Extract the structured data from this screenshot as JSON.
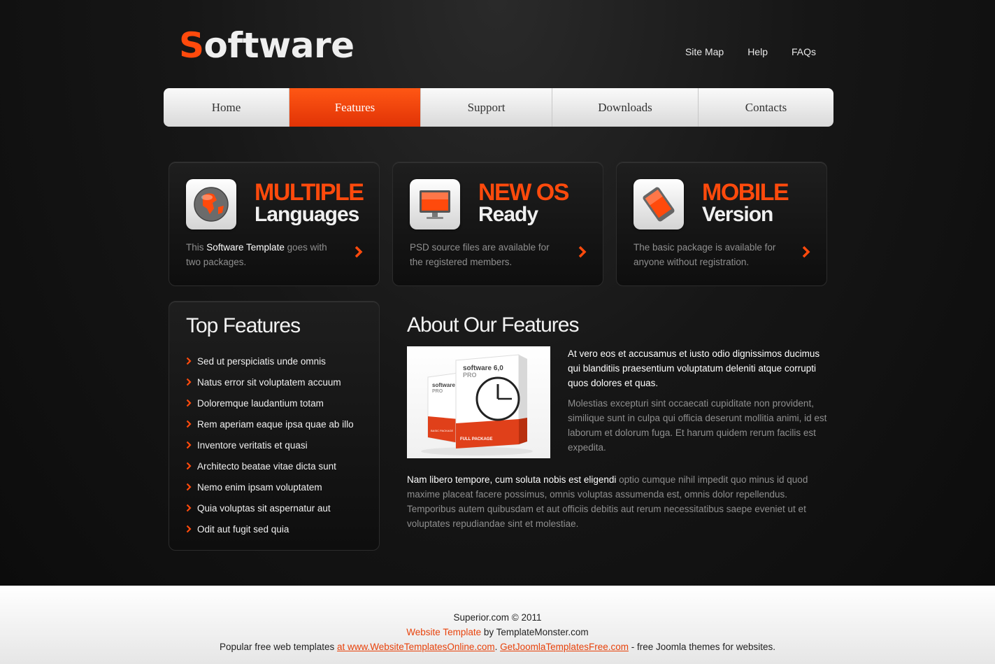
{
  "header": {
    "logo_first": "S",
    "logo_rest": "oftware",
    "links": [
      "Site Map",
      "Help",
      "FAQs"
    ]
  },
  "nav": {
    "items": [
      "Home",
      "Features",
      "Support",
      "Downloads",
      "Contacts"
    ],
    "active": "Features"
  },
  "boxes": [
    {
      "title1": "MULTIPLE",
      "title2": "Languages",
      "icon": "globe-icon",
      "desc_pre": "This ",
      "desc_hl": "Software Template",
      "desc_post": " goes with two packages."
    },
    {
      "title1": "NEW OS",
      "title2": "Ready",
      "icon": "monitor-icon",
      "desc": "PSD source files are available for the registered members."
    },
    {
      "title1": "MOBILE",
      "title2": "Version",
      "icon": "tablet-icon",
      "desc": "The basic package is available for anyone without registration."
    }
  ],
  "top_features": {
    "title": "Top Features",
    "items": [
      "Sed ut perspiciatis unde omnis",
      "Natus error sit voluptatem accuum",
      "Doloremque laudantium totam",
      "Rem aperiam eaque ipsa quae ab illo",
      "Inventore veritatis et quasi",
      "Architecto beatae vitae dicta sunt",
      "Nemo enim ipsam voluptatem",
      "Quia voluptas sit aspernatur aut",
      "Odit aut fugit sed quia"
    ]
  },
  "about": {
    "title": "About Our Features",
    "image_box_front_label": "software 6,0",
    "image_box_front_sub": "PRO",
    "image_box_front_tag": "FULL PACKAGE",
    "image_box_back_label": "software 6,",
    "image_box_back_sub": "PRO",
    "image_box_back_tag": "BASIC PACKAGE",
    "p1": "At vero eos et accusamus et iusto odio dignissimos ducimus qui blanditiis praesentium voluptatum deleniti atque corrupti quos dolores et quas.",
    "p2": "Molestias excepturi sint occaecati cupiditate non provident, similique sunt in culpa qui officia deserunt mollitia animi, id est laborum et dolorum fuga. Et harum quidem rerum facilis est expedita.",
    "p3_hl": "Nam libero tempore, cum soluta nobis est eligendi",
    "p3_rest": " optio cumque nihil impedit quo minus id quod maxime placeat facere possimus, omnis voluptas assumenda est, omnis dolor repellendus. Temporibus autem quibusdam et aut officiis debitis aut rerum necessitatibus saepe eveniet ut et voluptates repudiandae sint et molestiae."
  },
  "footer": {
    "copyright": "Superior.com © 2011",
    "template_link": "Website Template",
    "by": " by TemplateMonster.com",
    "line3_pre": "Popular free web templates ",
    "link1": "at www.WebsiteTemplatesOnline.com",
    "sep": ". ",
    "link2": "GetJoomlaTemplatesFree.com",
    "line3_post": " - free Joomla themes for websites."
  },
  "colors": {
    "accent": "#ff4a0c",
    "background": "#111111",
    "footer": "#f2f2f2"
  }
}
